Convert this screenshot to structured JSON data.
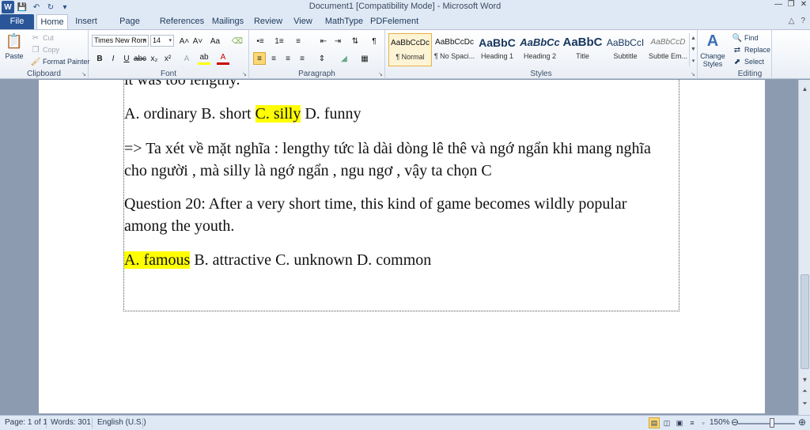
{
  "window": {
    "title": "Document1 [Compatibility Mode]  -  Microsoft Word",
    "app_icon": "W"
  },
  "tabs": [
    {
      "label": "File"
    },
    {
      "label": "Home"
    },
    {
      "label": "Insert"
    },
    {
      "label": "Page Layout"
    },
    {
      "label": "References"
    },
    {
      "label": "Mailings"
    },
    {
      "label": "Review"
    },
    {
      "label": "View"
    },
    {
      "label": "MathType"
    },
    {
      "label": "PDFelement"
    }
  ],
  "ribbon": {
    "clipboard": {
      "label": "Clipboard",
      "paste": "Paste",
      "cut": "Cut",
      "copy": "Copy",
      "format_painter": "Format Painter"
    },
    "font": {
      "label": "Font",
      "font_name": "Times New Rom",
      "font_size": "14"
    },
    "paragraph": {
      "label": "Paragraph"
    },
    "styles": {
      "label": "Styles",
      "items": [
        {
          "preview": "AaBbCcDc",
          "name": "¶ Normal"
        },
        {
          "preview": "AaBbCcDc",
          "name": "¶ No Spaci..."
        },
        {
          "preview": "AaBbC",
          "name": "Heading 1"
        },
        {
          "preview": "AaBbCc",
          "name": "Heading 2"
        },
        {
          "preview": "AaBbC",
          "name": "Title"
        },
        {
          "preview": "AaBbCcI",
          "name": "Subtitle"
        },
        {
          "preview": "AaBbCcD",
          "name": "Subtle Em..."
        }
      ],
      "change_styles": "Change Styles"
    },
    "editing": {
      "label": "Editing",
      "find": "Find",
      "replace": "Replace",
      "select": "Select"
    }
  },
  "document": {
    "line0": "it was too lengthy.",
    "p1_hl_before": "A. ordinary B. short ",
    "p1_hl": "C. silly",
    "p1_after": " D. funny",
    "p2_line1": "=> Ta xét về mặt nghĩa : lengthy tức là dài dòng lê thê và ngớ ngẩn khi mang nghĩa",
    "p2_line2": "cho người , mà silly là ngớ ngẩn , ngu ngơ  , vậy ta chọn C",
    "p3_line1": "Question 20: After a very short time, this kind of game becomes wildly popular",
    "p3_line2": "among the youth.",
    "p4_hl": "A. famous",
    "p4_after": " B. attractive C. unknown D. common"
  },
  "statusbar": {
    "page": "Page: 1 of 1",
    "words": "Words: 301",
    "language": "English (U.S.)",
    "zoom": "150%"
  }
}
